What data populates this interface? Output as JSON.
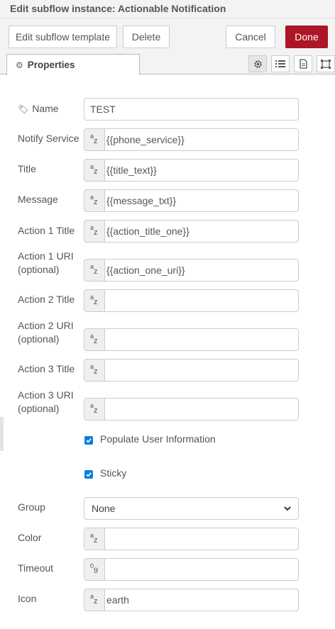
{
  "header": {
    "title": "Edit subflow instance: Actionable Notification"
  },
  "toolbar": {
    "edit_template_label": "Edit subflow template",
    "delete_label": "Delete",
    "cancel_label": "Cancel",
    "done_label": "Done"
  },
  "tabs": {
    "properties_label": "Properties"
  },
  "form": {
    "name": {
      "label": "Name",
      "value": "TEST"
    },
    "notify_service": {
      "label": "Notify Service",
      "value": "{{phone_service}}"
    },
    "title": {
      "label": "Title",
      "value": "{{title_text}}"
    },
    "message": {
      "label": "Message",
      "value": "{{message_txt}}"
    },
    "action1_title": {
      "label": "Action 1 Title",
      "value": "{{action_title_one}}"
    },
    "action1_uri": {
      "label1": "Action 1 URI",
      "label2": "(optional)",
      "value": "{{action_one_uri}}"
    },
    "action2_title": {
      "label": "Action 2 Title",
      "value": ""
    },
    "action2_uri": {
      "label1": "Action 2 URI",
      "label2": "(optional)",
      "value": ""
    },
    "action3_title": {
      "label": "Action 3 Title",
      "value": ""
    },
    "action3_uri": {
      "label1": "Action 3 URI",
      "label2": "(optional)",
      "value": ""
    },
    "populate_user_info": {
      "label": "Populate User Information",
      "checked": true
    },
    "sticky": {
      "label": "Sticky",
      "checked": true
    },
    "group": {
      "label": "Group",
      "value": "None"
    },
    "color": {
      "label": "Color",
      "value": ""
    },
    "timeout": {
      "label": "Timeout",
      "value": ""
    },
    "icon": {
      "label": "Icon",
      "value": "earth"
    }
  },
  "colors": {
    "done_button": "#ad1625",
    "checkbox": "#0a7ee0"
  }
}
